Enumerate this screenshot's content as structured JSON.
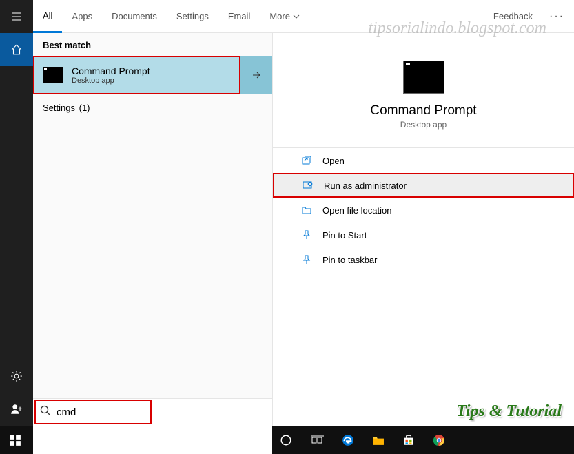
{
  "tabs": {
    "all": "All",
    "apps": "Apps",
    "documents": "Documents",
    "settings": "Settings",
    "email": "Email",
    "more": "More"
  },
  "feedback": "Feedback",
  "sections": {
    "best_match": "Best match",
    "settings_label": "Settings",
    "settings_count": "(1)"
  },
  "result": {
    "title": "Command Prompt",
    "subtitle": "Desktop app"
  },
  "detail": {
    "title": "Command Prompt",
    "subtitle": "Desktop app"
  },
  "actions": {
    "open": "Open",
    "run_admin": "Run as administrator",
    "open_location": "Open file location",
    "pin_start": "Pin to Start",
    "pin_taskbar": "Pin to taskbar"
  },
  "search": {
    "value": "cmd"
  },
  "watermarks": {
    "top": "tipsorialindo.blogspot.com",
    "bottom": "Tips & Tutorial"
  }
}
